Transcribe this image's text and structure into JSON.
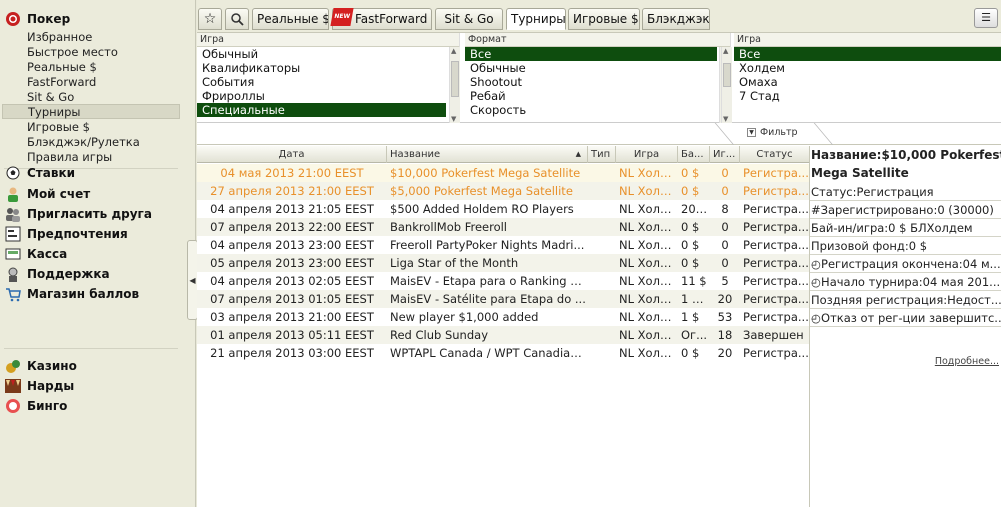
{
  "sidebar": {
    "poker": "Покер",
    "poker_items": [
      "Избранное",
      "Быстрое место",
      "Реальные $",
      "FastForward",
      "Sit & Go",
      "Турниры",
      "Игровые $",
      "Блэкджэк/Рулетка",
      "Правила игры"
    ],
    "stakes": "Ставки",
    "account": "Мой счет",
    "invite": "Пригласить друга",
    "prefs": "Предпочтения",
    "cashier": "Касса",
    "support": "Поддержка",
    "shop": "Магазин баллов",
    "casino": "Казино",
    "backgammon": "Нарды",
    "bingo": "Бинго"
  },
  "tabs": {
    "real": "Реальные $",
    "new_badge": "NEW",
    "fastforward": "FastForward",
    "sitgo": "Sit & Go",
    "tournaments": "Турниры",
    "play": "Игровые $",
    "blackjack": "Блэкджэк"
  },
  "filters": {
    "col1_header": "Игра",
    "col1_items": [
      "Обычный",
      "Квалификаторы",
      "События",
      "Фрироллы",
      "Специальные"
    ],
    "col2_header": "Формат",
    "col2_items": [
      "Все",
      "Обычные",
      "Shootout",
      "Ребай",
      "Скорость"
    ],
    "col3_header": "Игра",
    "col3_items": [
      "Все",
      "Холдем",
      "Омаха",
      "7 Стад"
    ],
    "filter_label": "Фильтр"
  },
  "table": {
    "headers": [
      "Дата",
      "Название",
      "Тип",
      "Игра",
      "Ба...",
      "Иг...",
      "Статус"
    ],
    "rows": [
      {
        "date": "04 мая 2013 21:00 EEST",
        "name": "$10,000 Pokerfest Mega Satellite",
        "type": "",
        "game": "NL Холдем",
        "buyin": "0 $",
        "players": "0",
        "status": "Регистра..."
      },
      {
        "date": "27 апреля 2013 21:00 EEST",
        "name": "$5,000 Pokerfest Mega Satellite",
        "type": "",
        "game": "NL Холдем",
        "buyin": "0 $",
        "players": "0",
        "status": "Регистра..."
      },
      {
        "date": "04 апреля 2013 21:05 EEST",
        "name": "$500 Added Holdem RO Players",
        "type": "",
        "game": "NL Холдем",
        "buyin": "20 ...",
        "players": "8",
        "status": "Регистра..."
      },
      {
        "date": "07 апреля 2013 22:00 EEST",
        "name": "BankrollMob Freeroll",
        "type": "",
        "game": "NL Холдем",
        "buyin": "0 $",
        "players": "0",
        "status": "Регистра..."
      },
      {
        "date": "04 апреля 2013 23:00 EEST",
        "name": "Freeroll PartyPoker Nights Madri...",
        "type": "",
        "game": "NL Холдем",
        "buyin": "0 $",
        "players": "0",
        "status": "Регистра..."
      },
      {
        "date": "05 апреля 2013 23:00 EEST",
        "name": "Liga Star of the Month",
        "type": "",
        "game": "NL Холдем",
        "buyin": "0 $",
        "players": "0",
        "status": "Регистра..."
      },
      {
        "date": "04 апреля 2013 02:05 EEST",
        "name": "MaisEV - Etapa para o Ranking d...",
        "type": "",
        "game": "NL Холдем",
        "buyin": "11 $",
        "players": "5",
        "status": "Регистра..."
      },
      {
        "date": "07 апреля 2013 01:05 EEST",
        "name": "MaisEV - Satélite para Etapa do ...",
        "type": "",
        "game": "NL Холдем",
        "buyin": "1 б...",
        "players": "20",
        "status": "Регистра..."
      },
      {
        "date": "03 апреля 2013 21:00 EEST",
        "name": "New player $1,000 added",
        "type": "",
        "game": "NL Холдем",
        "buyin": "1 $",
        "players": "53",
        "status": "Регистра..."
      },
      {
        "date": "01 апреля 2013 05:11 EEST",
        "name": "Red Club Sunday",
        "type": "",
        "game": "NL Холдем",
        "buyin": "Ог...",
        "players": "18",
        "status": "Завершен"
      },
      {
        "date": "21 апреля 2013 03:00 EEST",
        "name": "WPTAPL Canada / WPT Canadian...",
        "type": "",
        "game": "NL Холдем",
        "buyin": "0 $",
        "players": "20",
        "status": "Регистра..."
      }
    ]
  },
  "details": {
    "title1": "Название:$10,000 Pokerfest",
    "title2": "Mega Satellite",
    "status": "Статус:Регистрация",
    "registered": "#Зарегистрировано:0 (30000)",
    "buyin": "Бай-ин/игра:0 $ БЛХолдем",
    "prize": "Призовой фонд:0 $",
    "reg_end": "Регистрация окончена:04 м...",
    "start": "Начало турнира:04 мая 201...",
    "late_reg": "Поздняя регистрация:Недост...",
    "unreg": "Отказ от рег-ции завершитс...",
    "more": "Подробнее..."
  },
  "colors": {
    "highlight_row_text": "#e8902a",
    "selected_filter": "#0e4d0e"
  }
}
